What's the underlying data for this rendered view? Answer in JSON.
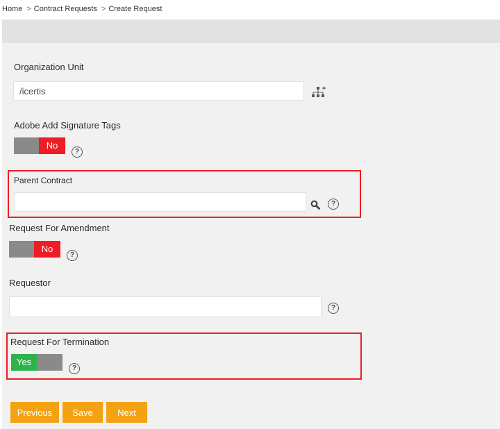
{
  "breadcrumb": {
    "items": [
      "Home",
      "Contract Requests",
      "Create Request"
    ],
    "separator": ">"
  },
  "form": {
    "organization_unit": {
      "label": "Organization Unit",
      "value": "/icertis",
      "icon": "org-hierarchy-icon"
    },
    "adobe_signature_tags": {
      "label": "Adobe Add Signature Tags",
      "state": "No"
    },
    "parent_contract": {
      "label": "Parent Contract",
      "value": "",
      "icon": "search-icon"
    },
    "request_for_amendment": {
      "label": "Request For Amendment",
      "state": "No"
    },
    "requestor": {
      "label": "Requestor",
      "value": ""
    },
    "request_for_termination": {
      "label": "Request For Termination",
      "state": "Yes"
    },
    "help_glyph": "?"
  },
  "buttons": {
    "previous": "Previous",
    "save": "Save",
    "next": "Next"
  },
  "colors": {
    "accent_button": "#f2a212",
    "toggle_no": "#ee1c25",
    "toggle_yes": "#2eb34a",
    "highlight": "#ee1c25"
  }
}
